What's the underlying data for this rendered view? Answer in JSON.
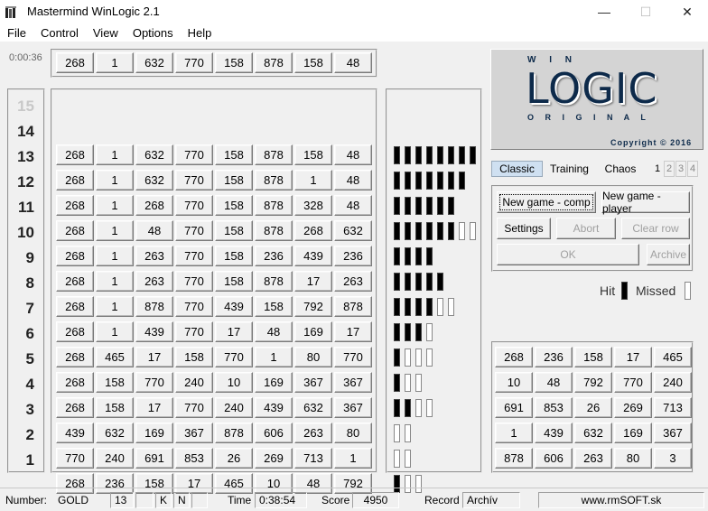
{
  "window": {
    "title": "Mastermind WinLogic 2.1"
  },
  "menu": [
    "File",
    "Control",
    "View",
    "Options",
    "Help"
  ],
  "timer": "0:00:36",
  "secret": [
    "268",
    "1",
    "632",
    "770",
    "158",
    "878",
    "158",
    "48"
  ],
  "rows": [
    {
      "num": "15",
      "values": [],
      "hits": 0,
      "misses": 0
    },
    {
      "num": "14",
      "values": [
        "268",
        "1",
        "632",
        "770",
        "158",
        "878",
        "158",
        "48"
      ],
      "hits": 8,
      "misses": 0
    },
    {
      "num": "13",
      "values": [
        "268",
        "1",
        "632",
        "770",
        "158",
        "878",
        "1",
        "48"
      ],
      "hits": 7,
      "misses": 0
    },
    {
      "num": "12",
      "values": [
        "268",
        "1",
        "268",
        "770",
        "158",
        "878",
        "328",
        "48"
      ],
      "hits": 6,
      "misses": 0
    },
    {
      "num": "11",
      "values": [
        "268",
        "1",
        "48",
        "770",
        "158",
        "878",
        "268",
        "632"
      ],
      "hits": 6,
      "misses": 2
    },
    {
      "num": "10",
      "values": [
        "268",
        "1",
        "263",
        "770",
        "158",
        "236",
        "439",
        "236"
      ],
      "hits": 4,
      "misses": 0
    },
    {
      "num": "9",
      "values": [
        "268",
        "1",
        "263",
        "770",
        "158",
        "878",
        "17",
        "263"
      ],
      "hits": 5,
      "misses": 0
    },
    {
      "num": "8",
      "values": [
        "268",
        "1",
        "878",
        "770",
        "439",
        "158",
        "792",
        "878"
      ],
      "hits": 4,
      "misses": 2
    },
    {
      "num": "7",
      "values": [
        "268",
        "1",
        "439",
        "770",
        "17",
        "48",
        "169",
        "17"
      ],
      "hits": 3,
      "misses": 1
    },
    {
      "num": "6",
      "values": [
        "268",
        "465",
        "17",
        "158",
        "770",
        "1",
        "80",
        "770"
      ],
      "hits": 1,
      "misses": 3
    },
    {
      "num": "5",
      "values": [
        "268",
        "158",
        "770",
        "240",
        "10",
        "169",
        "367",
        "367"
      ],
      "hits": 1,
      "misses": 2
    },
    {
      "num": "4",
      "values": [
        "268",
        "158",
        "17",
        "770",
        "240",
        "439",
        "632",
        "367"
      ],
      "hits": 2,
      "misses": 2
    },
    {
      "num": "3",
      "values": [
        "439",
        "632",
        "169",
        "367",
        "878",
        "606",
        "263",
        "80"
      ],
      "hits": 0,
      "misses": 2
    },
    {
      "num": "2",
      "values": [
        "770",
        "240",
        "691",
        "853",
        "26",
        "269",
        "713",
        "1"
      ],
      "hits": 0,
      "misses": 2
    },
    {
      "num": "1",
      "values": [
        "268",
        "236",
        "158",
        "17",
        "465",
        "10",
        "48",
        "792"
      ],
      "hits": 1,
      "misses": 2
    }
  ],
  "logo": {
    "top": "W I N",
    "main": "LOGIC",
    "bottom": "O R I G I N A L",
    "copyright": "Copyright © 2016"
  },
  "tabs": [
    "Classic",
    "Training",
    "Chaos"
  ],
  "page_tabs": [
    "1",
    "2",
    "3",
    "4"
  ],
  "buttons": {
    "new_comp": "New game - comp",
    "new_player": "New game - player",
    "settings": "Settings",
    "abort": "Abort",
    "clear_row": "Clear row",
    "ok": "OK",
    "archive": "Archive"
  },
  "legend": {
    "hit": "Hit",
    "missed": "Missed"
  },
  "palette": [
    [
      "268",
      "236",
      "158",
      "17",
      "465"
    ],
    [
      "10",
      "48",
      "792",
      "770",
      "240"
    ],
    [
      "691",
      "853",
      "26",
      "269",
      "713"
    ],
    [
      "1",
      "439",
      "632",
      "169",
      "367"
    ],
    [
      "878",
      "606",
      "263",
      "80",
      "3"
    ]
  ],
  "status": {
    "number_label": "Number:",
    "number_value": "GOLD",
    "count": "13",
    "k": "K",
    "n": "N",
    "time_label": "Time",
    "time_value": "0:38:54",
    "score_label": "Score",
    "score_value": "4950",
    "record_label": "Record",
    "record_value": "Archív",
    "website": "www.rmSOFT.sk"
  },
  "colors": {
    "hit": "#000000",
    "miss": "#ffffff",
    "logo": "#0d2a4a",
    "tab_active": "#cfe0f1"
  }
}
